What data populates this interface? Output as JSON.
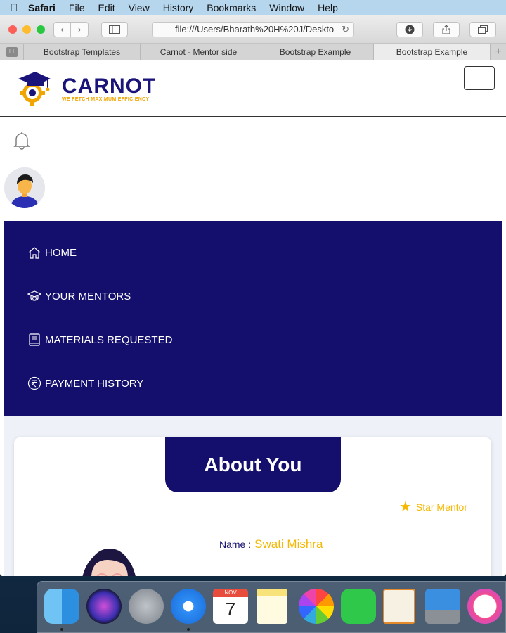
{
  "menubar": {
    "app": "Safari",
    "items": [
      "File",
      "Edit",
      "View",
      "History",
      "Bookmarks",
      "Window",
      "Help"
    ]
  },
  "browser": {
    "address": "file:///Users/Bharath%20H%20J/Deskto",
    "tabs": [
      "Bootstrap Templates",
      "Carnot - Mentor side",
      "Bootstrap Example",
      "Bootstrap Example"
    ],
    "active_tab": 3
  },
  "site": {
    "logo_name": "CARNOT",
    "logo_tagline": "WE FETCH MAXIMUM EFFICIENCY",
    "nav": [
      {
        "label": "HOME",
        "icon": "home-icon"
      },
      {
        "label": "YOUR MENTORS",
        "icon": "mentors-icon"
      },
      {
        "label": "MATERIALS REQUESTED",
        "icon": "book-icon"
      },
      {
        "label": "PAYMENT HISTORY",
        "icon": "rupee-icon"
      }
    ],
    "card_title": "About You",
    "badge": "Star Mentor",
    "name_label": "Name :",
    "name_value": "Swati Mishra"
  },
  "colors": {
    "brand_navy": "#140f6d",
    "accent_yellow": "#f5b800",
    "page_bg": "#eef1f8"
  },
  "dock": {
    "apps": [
      "finder",
      "siri",
      "launchpad",
      "safari",
      "calendar",
      "notes",
      "photos",
      "facetime",
      "pages",
      "keynote",
      "itunes"
    ],
    "calendar_month": "NOV",
    "calendar_day": "7"
  }
}
